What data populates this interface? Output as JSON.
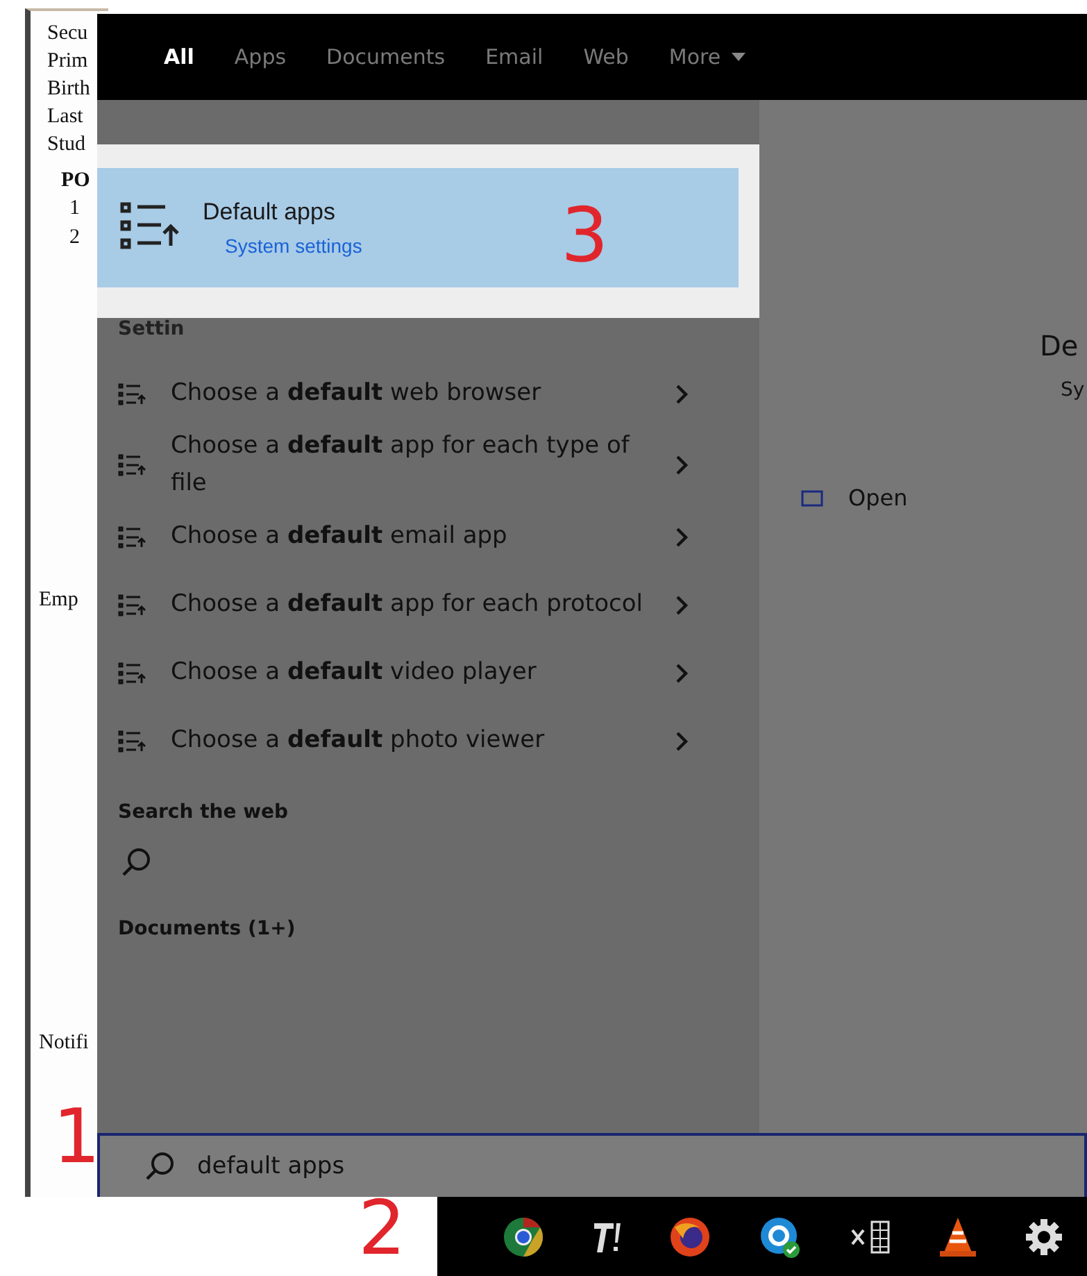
{
  "document": {
    "fields": [
      "Secu",
      "Prim",
      "Birth",
      "Last",
      "Stud"
    ],
    "section": "PO",
    "numbers": [
      "1",
      "2"
    ],
    "employer": "Emp",
    "footer": "Notifi"
  },
  "search_panel": {
    "tabs": [
      {
        "label": "All",
        "selected": true
      },
      {
        "label": "Apps",
        "selected": false
      },
      {
        "label": "Documents",
        "selected": false
      },
      {
        "label": "Email",
        "selected": false
      },
      {
        "label": "Web",
        "selected": false
      },
      {
        "label": "More",
        "selected": false,
        "dropdown": true
      }
    ],
    "best_match": {
      "title": "Default apps",
      "subtitle": "System settings",
      "selected": true
    },
    "settings_header": "Settin",
    "settings_items": [
      {
        "text": "Choose a **default** web browser"
      },
      {
        "text": "Choose a **default** app for each type of file"
      },
      {
        "text": "Choose a **default** email app"
      },
      {
        "text": "Choose a **default** app for each protocol"
      },
      {
        "text": "Choose a **default** video player"
      },
      {
        "text": "Choose a **default** photo viewer"
      }
    ],
    "web_header": "Search the web",
    "documents_header": "Documents (1+)",
    "preview": {
      "title": "De",
      "subtitle": "Sy",
      "action": "Open"
    },
    "search_box": {
      "value": "default apps"
    }
  },
  "annotations": [
    {
      "text": "1"
    },
    {
      "text": "2"
    },
    {
      "text": "3"
    }
  ]
}
